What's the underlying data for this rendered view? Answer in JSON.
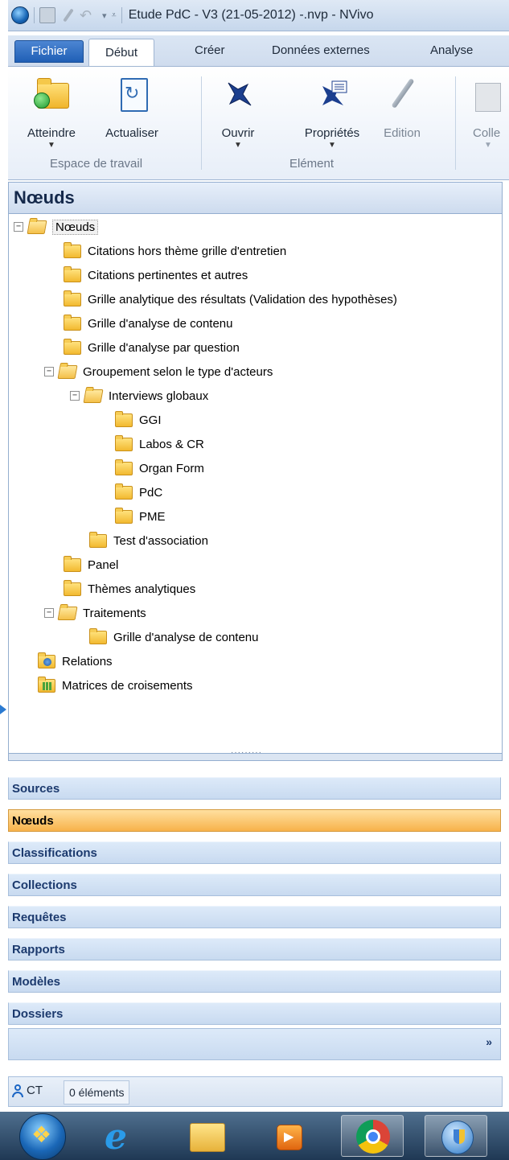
{
  "window": {
    "title": "Etude PdC - V3 (21-05-2012) -.nvp - NVivo"
  },
  "tabs": {
    "file": "Fichier",
    "items": [
      "Début",
      "Créer",
      "Données externes",
      "Analyse"
    ]
  },
  "ribbon": {
    "buttons": {
      "atteindre": "Atteindre",
      "actualiser": "Actualiser",
      "ouvrir": "Ouvrir",
      "proprietes": "Propriétés",
      "edition": "Edition",
      "coller": "Colle"
    },
    "groups": {
      "workspace": "Espace de travail",
      "element": "Elément"
    }
  },
  "nav": {
    "title": "Nœuds",
    "tree": [
      {
        "label": "Nœuds"
      },
      {
        "label": "Citations hors thème grille d'entretien"
      },
      {
        "label": "Citations pertinentes et autres"
      },
      {
        "label": "Grille analytique des résultats (Validation des hypothèses)"
      },
      {
        "label": "Grille d'analyse de contenu"
      },
      {
        "label": "Grille d'analyse par question"
      },
      {
        "label": "Groupement selon le type d'acteurs"
      },
      {
        "label": "Interviews globaux"
      },
      {
        "label": "GGI"
      },
      {
        "label": "Labos & CR"
      },
      {
        "label": "Organ Form"
      },
      {
        "label": "PdC"
      },
      {
        "label": "PME"
      },
      {
        "label": "Test d'association"
      },
      {
        "label": "Panel"
      },
      {
        "label": "Thèmes analytiques"
      },
      {
        "label": "Traitements"
      },
      {
        "label": "Grille d'analyse de contenu"
      },
      {
        "label": "Relations"
      },
      {
        "label": "Matrices de croisements"
      }
    ],
    "buttons": [
      "Sources",
      "Nœuds",
      "Classifications",
      "Collections",
      "Requêtes",
      "Rapports",
      "Modèles",
      "Dossiers"
    ],
    "more": "»"
  },
  "status": {
    "user": "CT",
    "count": "0 éléments"
  },
  "colors": {
    "active_nav": "#f7b24a",
    "nav_button": "#c8daf0",
    "ribbon_file_tab": "#1f5fb5"
  }
}
